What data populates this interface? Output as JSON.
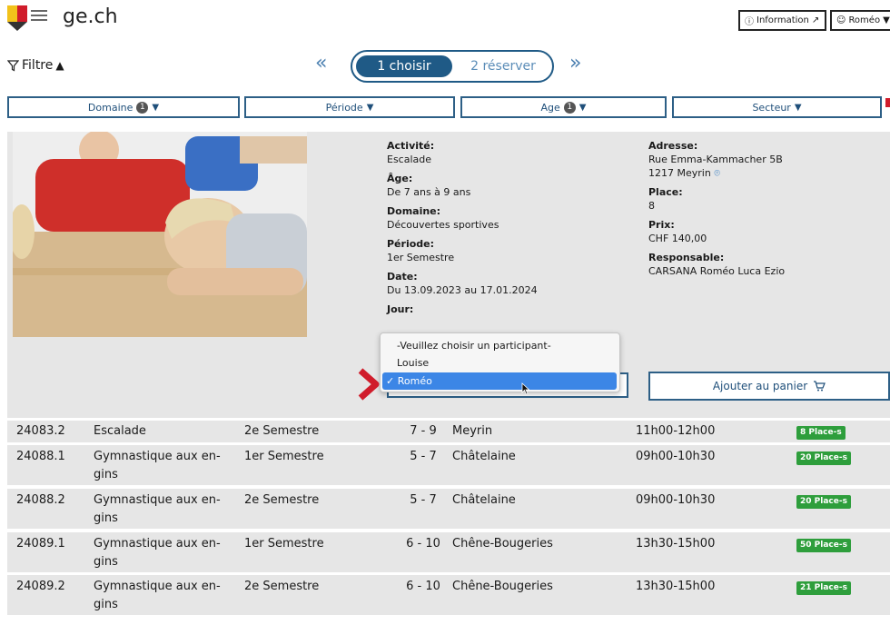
{
  "header": {
    "site_title": "ge.ch",
    "info_label": "Information",
    "user_label": "Roméo"
  },
  "filter": {
    "label": "Filtre"
  },
  "stepper": {
    "step1": "1 choisir",
    "step2": "2 réserver"
  },
  "filters": {
    "domaine": {
      "label": "Domaine",
      "badge": "1"
    },
    "periode": {
      "label": "Période"
    },
    "age": {
      "label": "Age",
      "badge": "1"
    },
    "secteur": {
      "label": "Secteur"
    }
  },
  "detail": {
    "activite_label": "Activité:",
    "activite": "Escalade",
    "age_label": "Âge:",
    "age": "De 7 ans à 9 ans",
    "domaine_label": "Domaine:",
    "domaine": "Découvertes sportives",
    "periode_label": "Période:",
    "periode": "1er Semestre",
    "date_label": "Date:",
    "date": "Du 13.09.2023 au 17.01.2024",
    "jour_label": "Jour:",
    "adresse_label": "Adresse:",
    "adresse_line1": "Rue Emma-Kammacher 5B",
    "adresse_line2": "1217 Meyrin",
    "place_label": "Place:",
    "place": "8",
    "prix_label": "Prix:",
    "prix": "CHF 140,00",
    "responsable_label": "Responsable:",
    "responsable": "CARSANA Roméo Luca Ezio"
  },
  "participant_dropdown": {
    "options": [
      "-Veuillez choisir un participant-",
      "Louise",
      "Roméo"
    ],
    "selected": "Roméo"
  },
  "add_to_cart": "Ajouter au panier",
  "colors": {
    "primary": "#1f5a86",
    "green": "#2e9e3c",
    "selected": "#3c86e6",
    "red": "#d01c2b"
  },
  "rows": [
    {
      "id": "24083.2",
      "activity": "Escalade",
      "activity2": "",
      "period": "2e Semestre",
      "age": "7 - 9",
      "place": "Meyrin",
      "time": "11h00-12h00",
      "places": "8 Place-s"
    },
    {
      "id": "24088.1",
      "activity": "Gymnastique aux en-",
      "activity2": "gins",
      "period": "1er Semestre",
      "age": "5 - 7",
      "place": "Châtelaine",
      "time": "09h00-10h30",
      "places": "20 Place-s"
    },
    {
      "id": "24088.2",
      "activity": "Gymnastique aux en-",
      "activity2": "gins",
      "period": "2e Semestre",
      "age": "5 - 7",
      "place": "Châtelaine",
      "time": "09h00-10h30",
      "places": "20 Place-s"
    },
    {
      "id": "24089.1",
      "activity": "Gymnastique aux en-",
      "activity2": "gins",
      "period": "1er Semestre",
      "age": "6 - 10",
      "place": "Chêne-Bougeries",
      "time": "13h30-15h00",
      "places": "50 Place-s"
    },
    {
      "id": "24089.2",
      "activity": "Gymnastique aux en-",
      "activity2": "gins",
      "period": "2e Semestre",
      "age": "6 - 10",
      "place": "Chêne-Bougeries",
      "time": "13h30-15h00",
      "places": "21 Place-s"
    }
  ]
}
